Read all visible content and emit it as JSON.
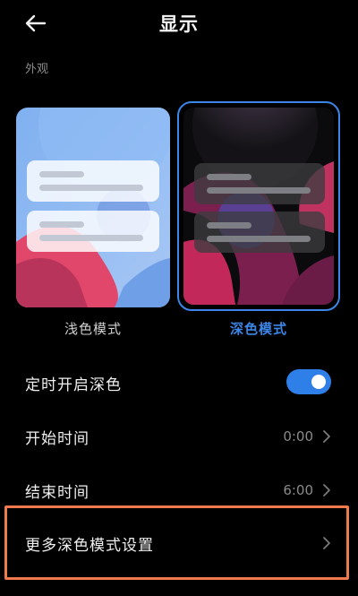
{
  "header": {
    "title": "显示",
    "back_icon": "arrow-left-icon"
  },
  "appearance": {
    "section_label": "外观",
    "light_label": "浅色模式",
    "dark_label": "深色模式",
    "selected": "dark"
  },
  "settings": {
    "schedule_dark": {
      "label": "定时开启深色",
      "enabled": true
    },
    "start_time": {
      "label": "开始时间",
      "value": "0:00"
    },
    "end_time": {
      "label": "结束时间",
      "value": "6:00"
    },
    "more_dark": {
      "label": "更多深色模式设置"
    }
  },
  "colors": {
    "accent": "#3b86e8",
    "highlight": "#ee7a4e",
    "background": "#000000"
  }
}
